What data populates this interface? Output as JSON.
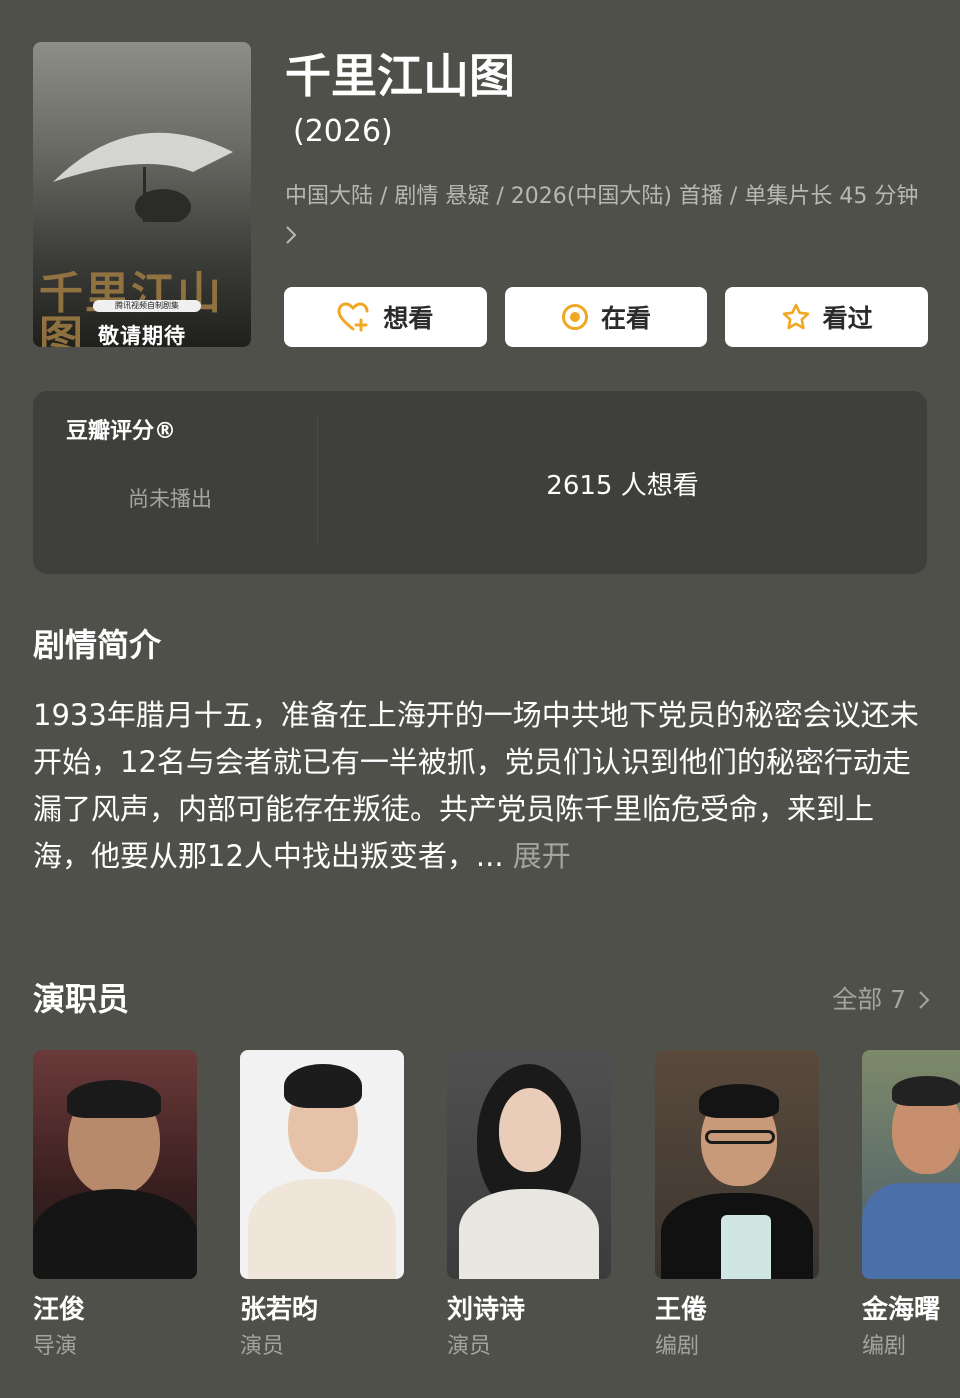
{
  "show": {
    "title": "千里江山图",
    "year": "(2026)",
    "meta": "中国大陆 / 剧情 悬疑 / 2026(中国大陆) 首播 / 单集片长 45 分钟",
    "poster_calligraphy": "千里江山图",
    "poster_tagline": "敬请期待",
    "poster_pill": "腾讯视频自制剧集"
  },
  "actions": [
    {
      "label": "想看",
      "icon": "heart-plus-icon"
    },
    {
      "label": "在看",
      "icon": "target-circle-icon"
    },
    {
      "label": "看过",
      "icon": "star-outline-icon"
    }
  ],
  "rating": {
    "label": "豆瓣评分®",
    "status": "尚未播出",
    "want_count": "2615 人想看"
  },
  "synopsis": {
    "heading": "剧情简介",
    "text": "1933年腊月十五，准备在上海开的一场中共地下党员的秘密会议还未开始，12名与会者就已有一半被抓，党员们认识到他们的秘密行动走漏了风声，内部可能存在叛徒。共产党员陈千里临危受命，来到上海，他要从那12人中找出叛变者，...",
    "more": "展开"
  },
  "cast": {
    "heading": "演职员",
    "all_label": "全部 7",
    "members": [
      {
        "name": "汪俊",
        "role": "导演"
      },
      {
        "name": "张若昀",
        "role": "演员"
      },
      {
        "name": "刘诗诗",
        "role": "演员"
      },
      {
        "name": "王倦",
        "role": "编剧"
      },
      {
        "name": "金海曙",
        "role": "编剧"
      }
    ]
  },
  "colors": {
    "background": "#4f504a",
    "panel": "#3f403b",
    "accent": "#f0a722",
    "muted_text": "#a3a49e"
  }
}
